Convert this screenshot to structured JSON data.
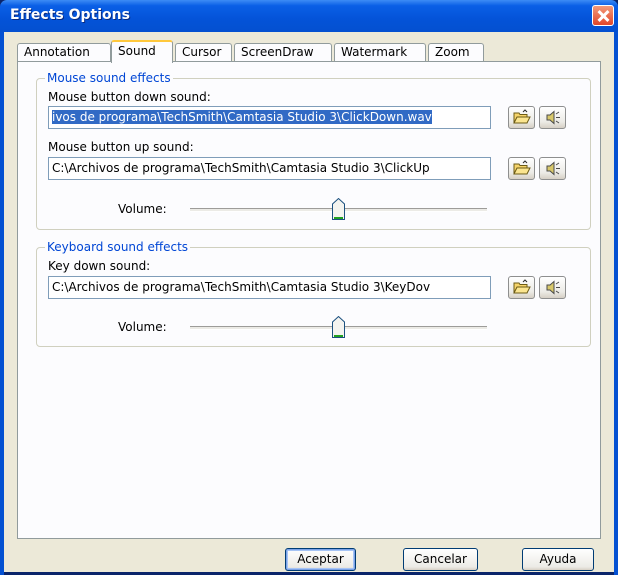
{
  "window": {
    "title": "Effects Options"
  },
  "tabs": [
    {
      "label": "Annotation"
    },
    {
      "label": "Sound"
    },
    {
      "label": "Cursor"
    },
    {
      "label": "ScreenDraw"
    },
    {
      "label": "Watermark"
    },
    {
      "label": "Zoom"
    }
  ],
  "active_tab": "Sound",
  "mouse_group": {
    "legend": "Mouse sound effects",
    "down_label": "Mouse button down sound:",
    "down_value": "ivos de programa\\TechSmith\\Camtasia Studio 3\\ClickDown.wav",
    "up_label": "Mouse button up sound:",
    "up_value": "C:\\Archivos de programa\\TechSmith\\Camtasia Studio 3\\ClickUp",
    "volume_label": "Volume:",
    "volume_level": 0.5
  },
  "keyboard_group": {
    "legend": "Keyboard sound effects",
    "key_label": "Key down sound:",
    "key_value": "C:\\Archivos de programa\\TechSmith\\Camtasia Studio 3\\KeyDov",
    "volume_label": "Volume:",
    "volume_level": 0.5
  },
  "icons": {
    "browse": "open-folder-icon",
    "play": "speaker-icon"
  },
  "buttons": {
    "ok": "Aceptar",
    "cancel": "Cancelar",
    "help": "Ayuda"
  },
  "colors": {
    "title_bar": "#0453d8",
    "legend_text": "#0046d5",
    "selection": "#316ac5",
    "active_tab_accent": "#ffc83c"
  }
}
